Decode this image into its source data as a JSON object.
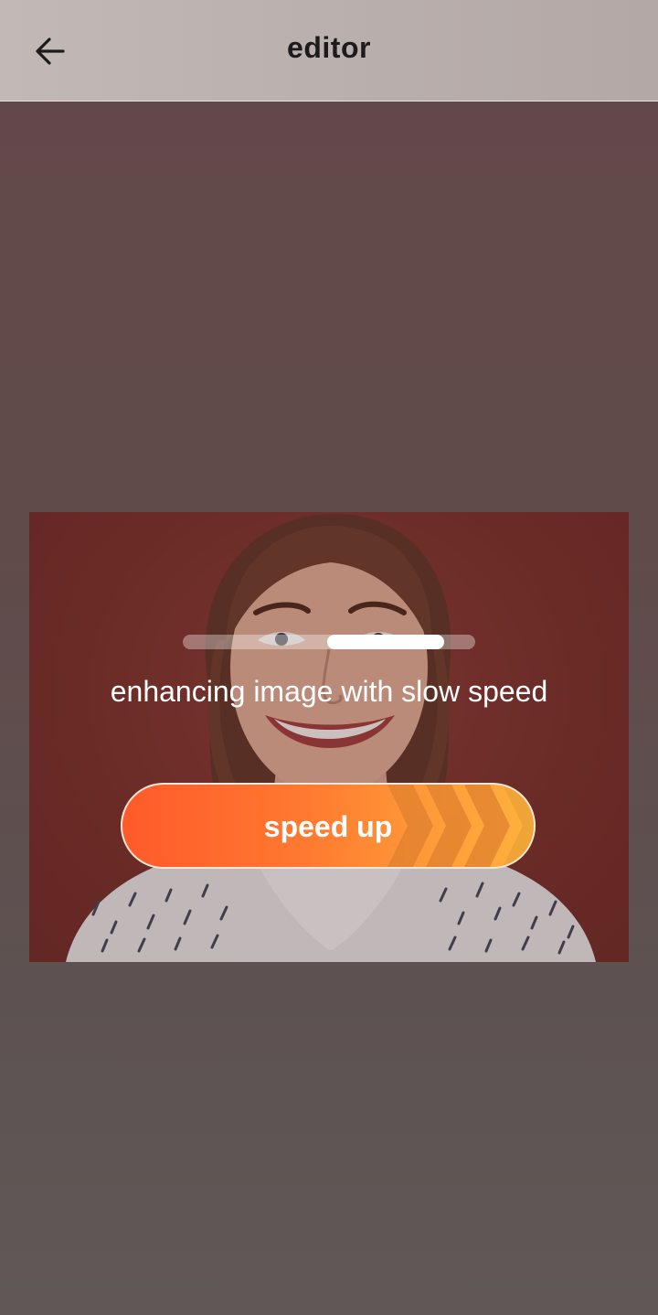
{
  "header": {
    "title": "editor",
    "back_icon": "arrow-left-icon"
  },
  "editor": {
    "status_text": "enhancing image with slow speed",
    "progress_indicator": "indeterminate",
    "speed_up_label": "speed up",
    "speed_up_icon": "chevrons-right-icon"
  },
  "colors": {
    "accent_start": "#ff5a2a",
    "accent_end": "#ffb23d",
    "header_bg": "#bcb2b0",
    "page_bg": "#62484a"
  }
}
